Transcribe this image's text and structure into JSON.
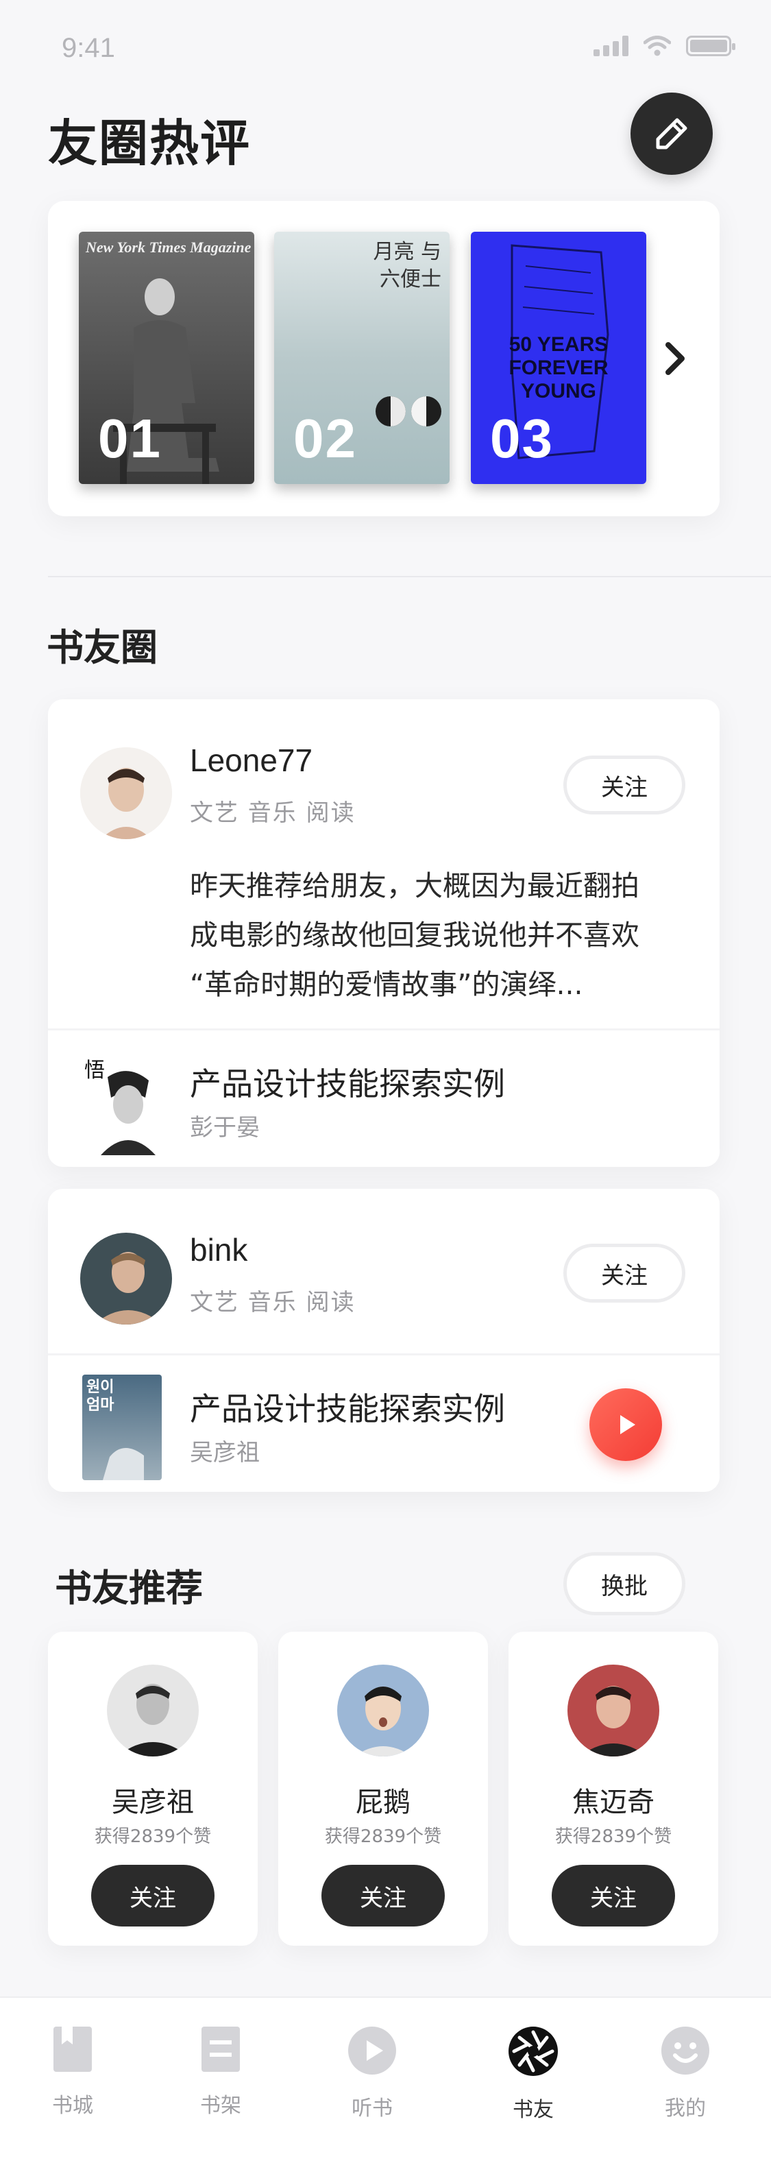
{
  "status_bar": {
    "time": "9:41"
  },
  "header": {
    "title": "友圈热评",
    "edit_icon": "pencil-icon"
  },
  "covers": {
    "items": [
      {
        "number": "01",
        "masthead": "New York Times Magazine"
      },
      {
        "number": "02",
        "title_a": "月亮",
        "title_b": "与",
        "title_c": "六便士"
      },
      {
        "number": "03",
        "cover_text_1": "50 YEARS",
        "cover_text_2": "FOREVER YOUNG"
      }
    ]
  },
  "circle": {
    "title": "书友圈",
    "posts": [
      {
        "username": "Leone77",
        "tags": "文艺 音乐 阅读",
        "follow_label": "关注",
        "text_line1": "昨天推荐给朋友，大概因为最近翻拍",
        "text_line2": "成电影的缘故他回复我说他并不喜欢",
        "text_line3": "“革命时期的爱情故事”的演绎...",
        "book": {
          "title": "产品设计技能探索实例",
          "author": "彭于晏"
        }
      },
      {
        "username": "bink",
        "tags": "文艺 音乐 阅读",
        "follow_label": "关注",
        "book": {
          "title": "产品设计技能探索实例",
          "author": "吴彦祖",
          "cover_text_1": "원이",
          "cover_text_2": "엄마"
        }
      }
    ]
  },
  "recommend": {
    "title": "书友推荐",
    "refresh_label": "换批",
    "users": [
      {
        "name": "吴彦祖",
        "likes": "获得2839个赞",
        "follow_label": "关注"
      },
      {
        "name": "屁鹅",
        "likes": "获得2839个赞",
        "follow_label": "关注"
      },
      {
        "name": "焦迈奇",
        "likes": "获得2839个赞",
        "follow_label": "关注"
      }
    ]
  },
  "tabbar": {
    "items": [
      {
        "label": "书城",
        "icon": "bookstore-icon"
      },
      {
        "label": "书架",
        "icon": "bookshelf-icon"
      },
      {
        "label": "听书",
        "icon": "play-circle-icon"
      },
      {
        "label": "书友",
        "icon": "aperture-icon"
      },
      {
        "label": "我的",
        "icon": "profile-face-icon"
      }
    ],
    "active": "书友"
  },
  "colors": {
    "accent_red": "#f43d35",
    "dark_button": "#2b2b2b",
    "cover3_blue": "#2f2ff0"
  }
}
